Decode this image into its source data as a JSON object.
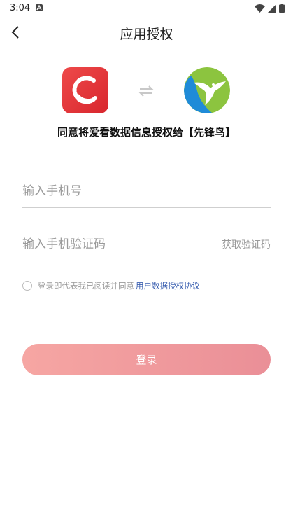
{
  "status_bar": {
    "time": "3:04",
    "icons": [
      "notification-a-icon",
      "wifi-icon",
      "signal-icon",
      "battery-icon"
    ]
  },
  "header": {
    "title": "应用授权",
    "back_icon": "chevron-left-icon"
  },
  "logos": {
    "app_logo": "app-logo-red-c",
    "swap_icon": "swap-arrows-icon",
    "partner_logo": "partner-bird-logo"
  },
  "consent": {
    "title": "同意将爱看数据信息授权给【先锋鸟】"
  },
  "form": {
    "phone_placeholder": "输入手机号",
    "code_placeholder": "输入手机验证码",
    "get_code_label": "获取验证码"
  },
  "agreement": {
    "text": "登录即代表我已阅读并同意",
    "link_text": "用户数据授权协议"
  },
  "login": {
    "label": "登录"
  },
  "colors": {
    "accent_link": "#3a5fb0",
    "button_start": "#f6a6a3",
    "button_end": "#ea8f97",
    "app_logo_red": "#e2333a",
    "partner_green": "#8cc43f",
    "partner_blue": "#1f8bd8"
  }
}
